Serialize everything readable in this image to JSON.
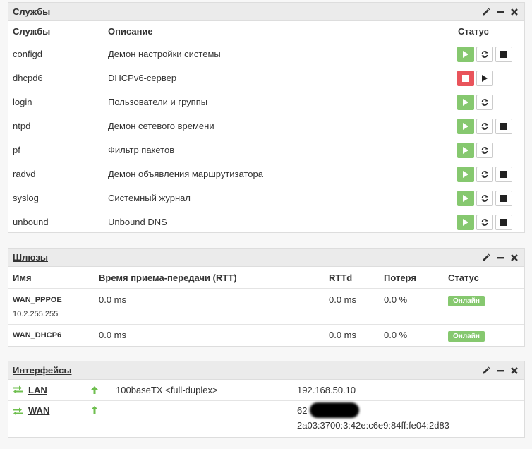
{
  "services": {
    "title": "Службы",
    "headers": {
      "name": "Службы",
      "description": "Описание",
      "status": "Статус"
    },
    "rows": [
      {
        "name": "configd",
        "description": "Демон настройки системы"
      },
      {
        "name": "dhcpd6",
        "description": "DHCPv6-сервер"
      },
      {
        "name": "login",
        "description": "Пользователи и группы"
      },
      {
        "name": "ntpd",
        "description": "Демон сетевого времени"
      },
      {
        "name": "pf",
        "description": "Фильтр пакетов"
      },
      {
        "name": "radvd",
        "description": "Демон объявления маршрутизатора"
      },
      {
        "name": "syslog",
        "description": "Системный журнал"
      },
      {
        "name": "unbound",
        "description": "Unbound DNS"
      }
    ]
  },
  "gateways": {
    "title": "Шлюзы",
    "headers": {
      "name": "Имя",
      "rtt": "Время приема-передачи (RTT)",
      "rttd": "RTTd",
      "loss": "Потеря",
      "status": "Статус"
    },
    "rows": [
      {
        "name": "WAN_PPPOE",
        "address": "10.2.255.255",
        "rtt": "0.0 ms",
        "rttd": "0.0 ms",
        "loss": "0.0 %",
        "status": "Онлайн"
      },
      {
        "name": "WAN_DHCP6",
        "address": "",
        "rtt": "0.0 ms",
        "rttd": "0.0 ms",
        "loss": "0.0 %",
        "status": "Онлайн"
      }
    ]
  },
  "interfaces": {
    "title": "Интерфейсы",
    "rows": [
      {
        "name": "LAN",
        "media": "100baseTX <full-duplex>",
        "ipv4": "192.168.50.10",
        "ipv6": ""
      },
      {
        "name": "WAN",
        "media": "",
        "ipv4": "62",
        "ipv6": "2a03:3700:3:42e:c6e9:84ff:fe04:2d83"
      }
    ]
  },
  "colors": {
    "accent_green": "#86c86f",
    "stop_red": "#e9545b",
    "arrow_green": "#6fbf4f"
  }
}
